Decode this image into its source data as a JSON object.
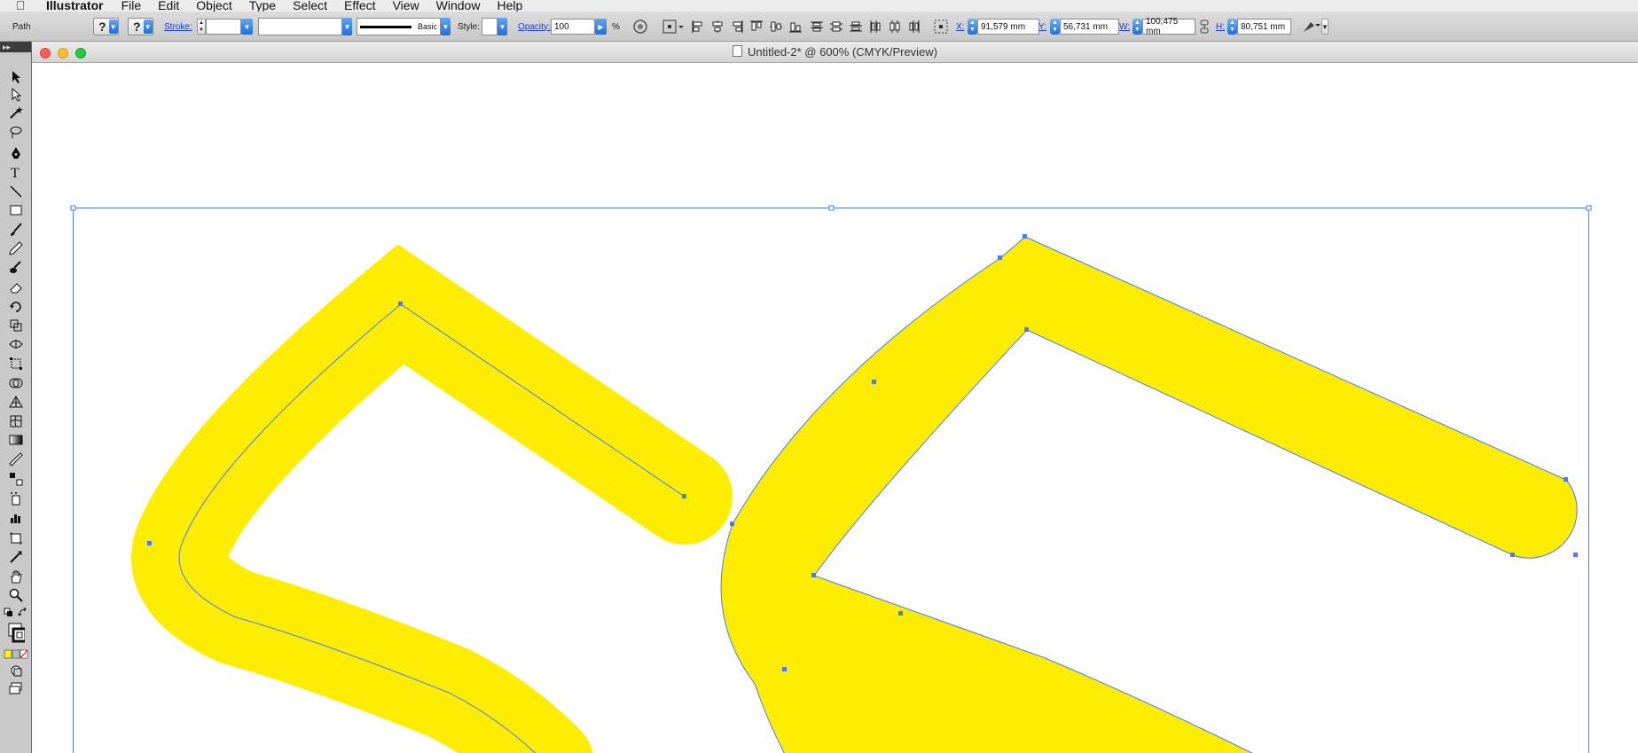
{
  "menubar": {
    "app_name": "Illustrator",
    "items": [
      "File",
      "Edit",
      "Object",
      "Type",
      "Select",
      "Effect",
      "View",
      "Window",
      "Help"
    ]
  },
  "control_bar": {
    "selection_type": "Path",
    "fill_value": "?",
    "stroke_color_value": "?",
    "stroke_label": "Stroke:",
    "stroke_weight": "",
    "stroke_profile": "Basic",
    "style_label": "Style:",
    "opacity_label": "Opacity:",
    "opacity_value": "100",
    "opacity_unit": "%",
    "x_label": "X:",
    "x_value": "91,579 mm",
    "y_label": "Y:",
    "y_value": "56,731 mm",
    "w_label": "W:",
    "w_value": "100,475 mm",
    "h_label": "H:",
    "h_value": "80,751 mm"
  },
  "document": {
    "title": "Untitled-2* @ 600% (CMYK/Preview)"
  },
  "colors": {
    "fill_yellow": "#ffed00",
    "selection_blue": "#4a7bff",
    "canvas_bg": "#ffffff"
  }
}
